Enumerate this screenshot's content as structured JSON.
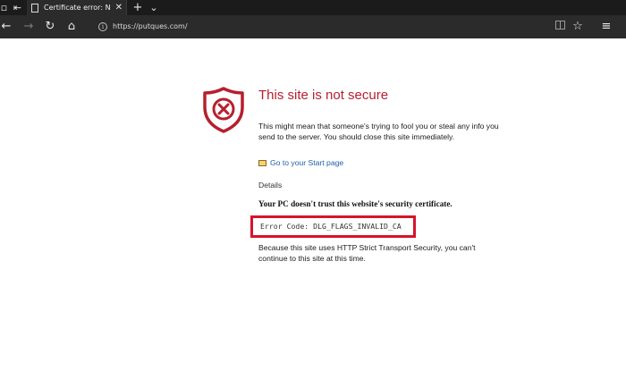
{
  "tabbar": {
    "tab_title": "Certificate error: Naviga",
    "tab_close_glyph": "✕",
    "new_tab_glyph": "+",
    "tab_list_glyph": "⌄"
  },
  "navbar": {
    "url": "https://putques.com/",
    "back_glyph": "←",
    "forward_glyph": "→",
    "refresh_glyph": "↻",
    "home_glyph": "⌂",
    "favorite_glyph": "☆",
    "hub_glyph": "≡",
    "info_glyph": "i"
  },
  "page": {
    "title": "This site is not secure",
    "description": "This might mean that someone's trying to fool you or steal any info you send to the server. You should close this site immediately.",
    "start_link": "Go to your Start page",
    "details_label": "Details",
    "trust_message": "Your PC doesn't trust this website's security certificate.",
    "error_code": "Error Code:  DLG_FLAGS_INVALID_CA",
    "hsts_message": "Because this site uses HTTP Strict Transport Security, you can't continue to this site at this time."
  },
  "colors": {
    "accent_red": "#b71f2e",
    "highlight_box": "#d6142b",
    "link_blue": "#1f5fa8",
    "chrome_dark": "#2b2b2b"
  }
}
